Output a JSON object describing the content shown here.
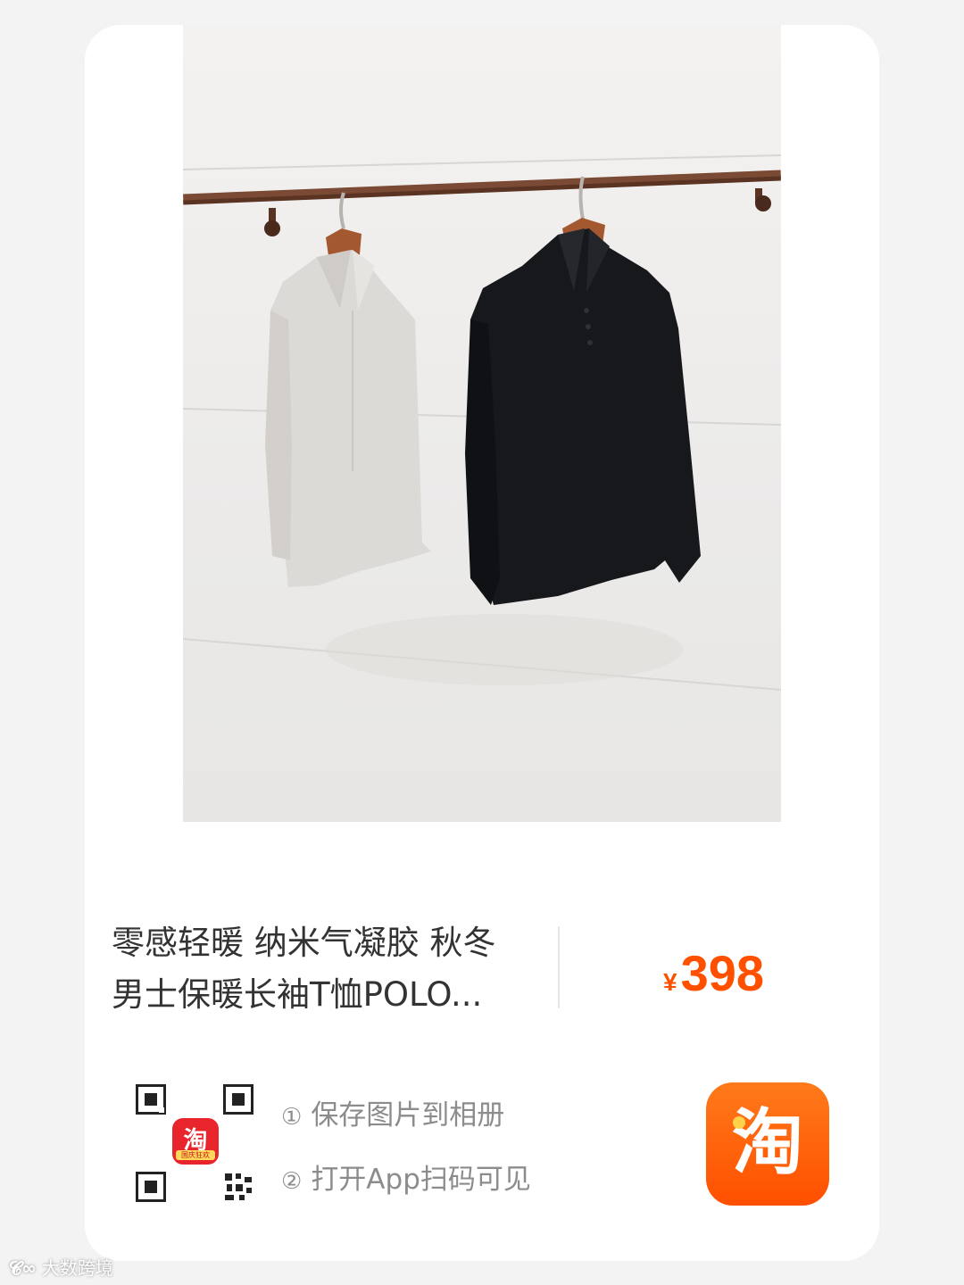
{
  "product": {
    "title_line1": "零感轻暖 纳米气凝胶 秋冬",
    "title_line2": "男士保暖长袖T恤POLO...",
    "currency": "¥",
    "price": "398"
  },
  "qr": {
    "logo_text": "淘",
    "logo_caption": "国庆狂欢"
  },
  "steps": [
    {
      "num": "①",
      "label": "保存图片到相册"
    },
    {
      "num": "②",
      "label": "打开App扫码可见"
    }
  ],
  "app_icon": {
    "glyph": "淘"
  },
  "watermark": {
    "mark": "𝓒∞",
    "text": "大数跨境"
  },
  "colors": {
    "price": "#ff5000",
    "taobao_orange": "#ff5000",
    "qr_logo_red": "#e8252c"
  }
}
